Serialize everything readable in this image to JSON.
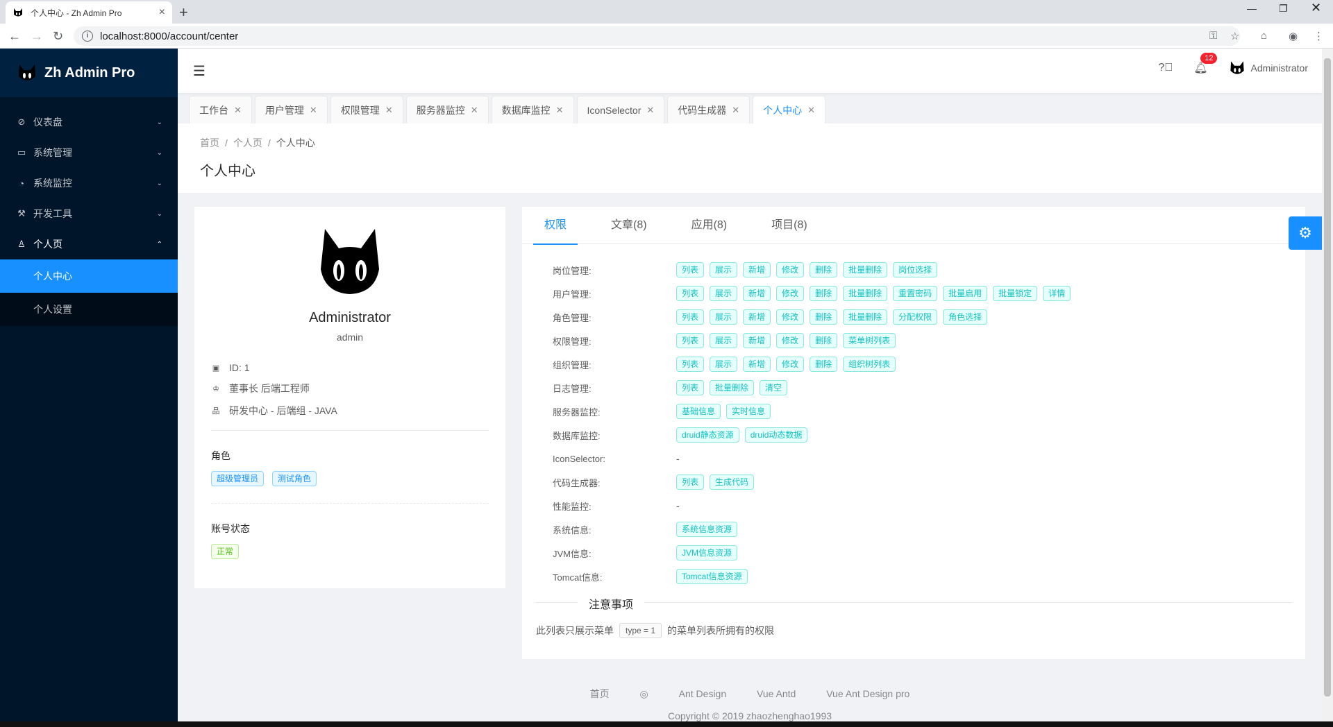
{
  "browser": {
    "tab_title": "个人中心 - Zh Admin Pro",
    "url": "localhost:8000/account/center"
  },
  "app": {
    "name": "Zh Admin Pro"
  },
  "sidebar": {
    "items": [
      {
        "label": "仪表盘",
        "icon": "dashboard-icon"
      },
      {
        "label": "系统管理",
        "icon": "desktop-icon"
      },
      {
        "label": "系统监控",
        "icon": "monitor-icon"
      },
      {
        "label": "开发工具",
        "icon": "tool-icon"
      },
      {
        "label": "个人页",
        "icon": "user-icon"
      }
    ],
    "sub_items": [
      {
        "label": "个人中心",
        "active": true
      },
      {
        "label": "个人设置",
        "active": false
      }
    ]
  },
  "header": {
    "notification_count": "12",
    "username": "Administrator"
  },
  "page_tabs": [
    "工作台",
    "用户管理",
    "权限管理",
    "服务器监控",
    "数据库监控",
    "IconSelector",
    "代码生成器",
    "个人中心"
  ],
  "breadcrumb": [
    "首页",
    "个人页",
    "个人中心"
  ],
  "page_title": "个人中心",
  "profile": {
    "name": "Administrator",
    "username": "admin",
    "id_line": "ID: 1",
    "position": "董事长 后端工程师",
    "dept": "研发中心 - 后端组 - JAVA",
    "roles_title": "角色",
    "roles": [
      "超级管理员",
      "测试角色"
    ],
    "status_title": "账号状态",
    "status": "正常"
  },
  "detail_tabs": [
    "权限",
    "文章(8)",
    "应用(8)",
    "项目(8)"
  ],
  "permissions": [
    {
      "label": "岗位管理:",
      "tags": [
        "列表",
        "展示",
        "新增",
        "修改",
        "删除",
        "批量删除",
        "岗位选择"
      ]
    },
    {
      "label": "用户管理:",
      "tags": [
        "列表",
        "展示",
        "新增",
        "修改",
        "删除",
        "批量删除",
        "重置密码",
        "批量启用",
        "批量锁定",
        "详情"
      ]
    },
    {
      "label": "角色管理:",
      "tags": [
        "列表",
        "展示",
        "新增",
        "修改",
        "删除",
        "批量删除",
        "分配权限",
        "角色选择"
      ]
    },
    {
      "label": "权限管理:",
      "tags": [
        "列表",
        "展示",
        "新增",
        "修改",
        "删除",
        "菜单树列表"
      ]
    },
    {
      "label": "组织管理:",
      "tags": [
        "列表",
        "展示",
        "新增",
        "修改",
        "删除",
        "组织树列表"
      ]
    },
    {
      "label": "日志管理:",
      "tags": [
        "列表",
        "批量删除",
        "清空"
      ]
    },
    {
      "label": "服务器监控:",
      "tags": [
        "基础信息",
        "实时信息"
      ]
    },
    {
      "label": "数据库监控:",
      "tags": [
        "druid静态资源",
        "druid动态数据"
      ]
    },
    {
      "label": "IconSelector:",
      "tags": []
    },
    {
      "label": "代码生成器:",
      "tags": [
        "列表",
        "生成代码"
      ]
    },
    {
      "label": "性能监控:",
      "tags": []
    },
    {
      "label": "系统信息:",
      "tags": [
        "系统信息资源"
      ]
    },
    {
      "label": "JVM信息:",
      "tags": [
        "JVM信息资源"
      ]
    },
    {
      "label": "Tomcat信息:",
      "tags": [
        "Tomcat信息资源"
      ]
    }
  ],
  "empty_value": "-",
  "notice": {
    "title": "注意事项",
    "before": "此列表只展示菜单",
    "code": "type = 1",
    "after": "的菜单列表所拥有的权限"
  },
  "footer": {
    "links": [
      "首页",
      "Ant Design",
      "Vue Antd",
      "Vue Ant Design pro"
    ],
    "copyright": "Copyright © 2019 zhaozhenghao1993"
  },
  "colors": {
    "primary": "#1890ff",
    "sider": "#001529",
    "tag_cyan": "#13c2c2"
  }
}
